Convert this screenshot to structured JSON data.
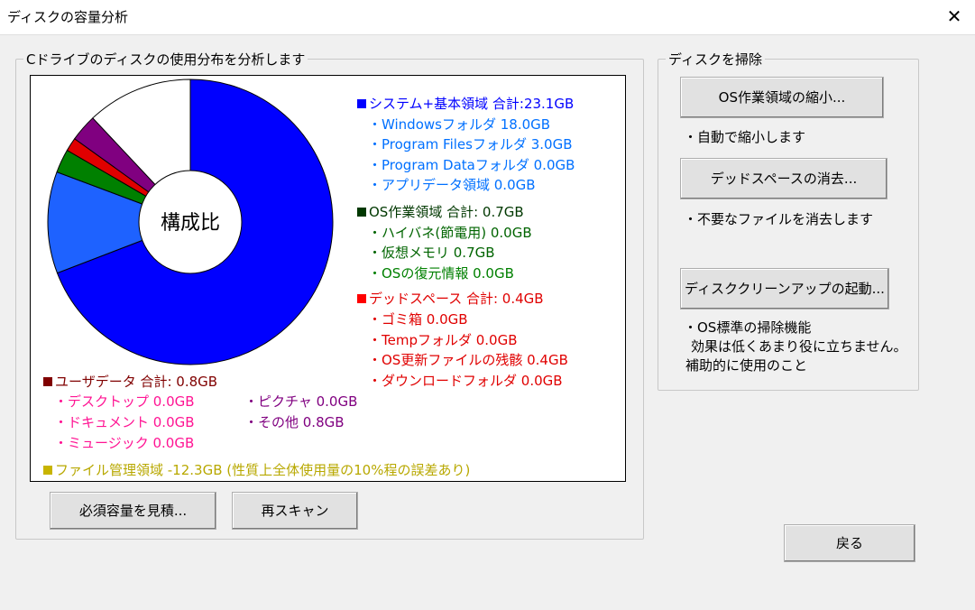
{
  "window": {
    "title": "ディスクの容量分析",
    "close_glyph": "✕"
  },
  "analysis": {
    "group_label": "Cドライブのディスクの使用分布を分析します",
    "center_label": "構成比",
    "system": {
      "header": "システム+基本領域 合計:23.1GB",
      "color": "#0000ff",
      "items": [
        "・Windowsフォルダ 18.0GB",
        "・Program Filesフォルダ 3.0GB",
        "・Program Dataフォルダ 0.0GB",
        "・アプリデータ領域 0.0GB"
      ]
    },
    "os": {
      "header": "OS作業領域 合計: 0.7GB",
      "color": "#006400",
      "items": [
        "・ハイバネ(節電用) 0.0GB",
        "・仮想メモリ 0.7GB",
        "・OSの復元情報 0.0GB"
      ]
    },
    "dead": {
      "header": "デッドスペース 合計: 0.4GB",
      "color": "#e00000",
      "items": [
        "・ゴミ箱 0.0GB",
        "・Tempフォルダ 0.0GB",
        "・OS更新ファイルの残骸 0.4GB",
        "・ダウンロードフォルダ 0.0GB"
      ]
    },
    "user": {
      "header": "ユーザデータ 合計: 0.8GB",
      "color": "#800000",
      "items_left": [
        "・デスクトップ 0.0GB",
        "・ドキュメント 0.0GB",
        "・ミュージック 0.0GB"
      ],
      "items_right": [
        "・ピクチャ 0.0GB",
        "・その他 0.8GB"
      ]
    },
    "filemgmt": {
      "label": "ファイル管理領域 -12.3GB (性質上全体使用量の10%程の誤差あり)",
      "color": "#b8a800"
    }
  },
  "colors": {
    "system_items": "#0070ff",
    "os_items": "#008000",
    "dead_items": "#e00000",
    "user_items": "#ff1493",
    "other_items": "#800080"
  },
  "chart_data": {
    "type": "pie",
    "categories": [
      "Windowsフォルダ",
      "Program Filesフォルダ",
      "Program Dataフォルダ",
      "アプリデータ領域",
      "仮想メモリ",
      "OS更新ファイルの残骸",
      "その他"
    ],
    "values": [
      18.0,
      3.0,
      0.0,
      0.0,
      0.7,
      0.4,
      0.8
    ],
    "colors": [
      "#0000ff",
      "#1e62ff",
      "#5aa8ff",
      "#28c8ff",
      "#008000",
      "#e00000",
      "#800080"
    ],
    "remaining_color": "#ffffff"
  },
  "buttons": {
    "estimate": "必須容量を見積...",
    "rescan": "再スキャン",
    "back": "戻る"
  },
  "cleanup": {
    "group_label": "ディスクを掃除",
    "shrink_button": "OS作業領域の縮小...",
    "shrink_desc": "・自動で縮小します",
    "dead_button": "デッドスペースの消去...",
    "dead_desc": "・不要なファイルを消去します",
    "cleanmgr_button": "ディスククリーンアップの起動...",
    "cleanmgr_desc": [
      "・OS標準の掃除機能",
      "効果は低くあまり役に立ちません。",
      "補助的に使用のこと"
    ]
  }
}
